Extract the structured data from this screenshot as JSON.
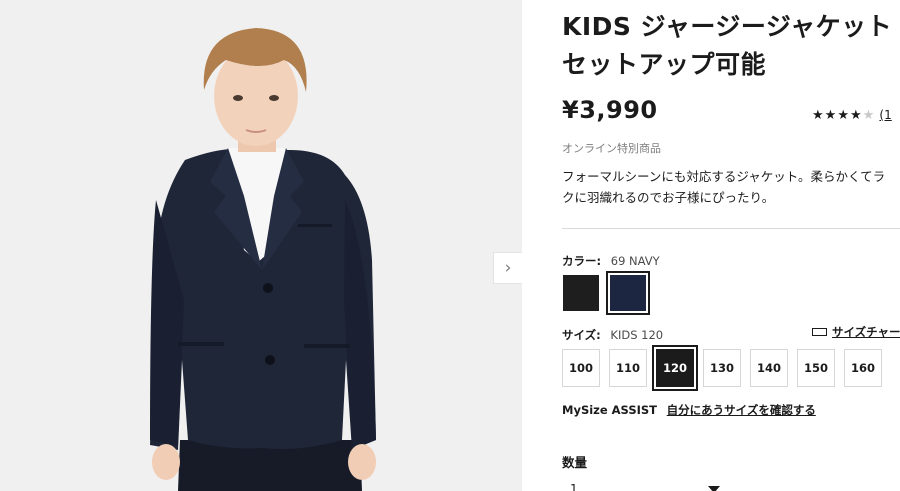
{
  "product": {
    "title_line1": "KIDS ジャージージャケット",
    "title_line2": "セットアップ可能",
    "price": "¥3,990",
    "rating": {
      "stars": 4,
      "max": 5,
      "count_text": "(1"
    },
    "online_only": "オンライン特別商品",
    "description_line1": "フォーマルシーンにも対応するジャケット。柔らかくてラ",
    "description_line2": "クに羽織れるのでお子様にぴったり。"
  },
  "color": {
    "label": "カラー:",
    "selected": "69 NAVY",
    "swatches": [
      {
        "name": "black",
        "hex": "#1e1e1e"
      },
      {
        "name": "navy",
        "hex": "#1c2640"
      }
    ],
    "selected_index": 1
  },
  "size": {
    "label": "サイズ:",
    "selected": "KIDS 120",
    "guide_label": "サイズチャー",
    "options": [
      "100",
      "110",
      "120",
      "130",
      "140",
      "150",
      "160"
    ],
    "selected_index": 2
  },
  "mysize": {
    "brand": "MySize ASSIST",
    "link": "自分にあうサイズを確認する"
  },
  "quantity": {
    "label": "数量",
    "value": "1"
  },
  "image_nav": {
    "next_icon": "chevron-right-icon"
  }
}
